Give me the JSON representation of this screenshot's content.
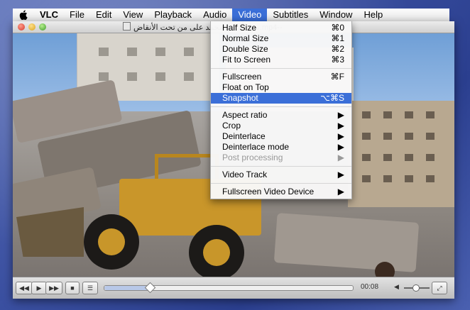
{
  "menubar": {
    "items": [
      "VLC",
      "File",
      "Edit",
      "View",
      "Playback",
      "Audio",
      "Video",
      "Subtitles",
      "Window",
      "Help"
    ],
    "active": "Video"
  },
  "window": {
    "title": "مفاجأة في محمد على من تحت الأنقاض.mp4--"
  },
  "video_menu": {
    "items": [
      {
        "label": "Half Size",
        "shortcut": "⌘0"
      },
      {
        "label": "Normal Size",
        "shortcut": "⌘1"
      },
      {
        "label": "Double Size",
        "shortcut": "⌘2"
      },
      {
        "label": "Fit to Screen",
        "shortcut": "⌘3"
      },
      {
        "label": "Fullscreen",
        "shortcut": "⌘F"
      },
      {
        "label": "Float on Top",
        "shortcut": ""
      },
      {
        "label": "Snapshot",
        "shortcut": "⌥⌘S"
      },
      {
        "label": "Aspect ratio",
        "shortcut": "▶"
      },
      {
        "label": "Crop",
        "shortcut": "▶"
      },
      {
        "label": "Deinterlace",
        "shortcut": "▶"
      },
      {
        "label": "Deinterlace mode",
        "shortcut": "▶"
      },
      {
        "label": "Post processing",
        "shortcut": "▶"
      },
      {
        "label": "Video Track",
        "shortcut": "▶"
      },
      {
        "label": "Fullscreen Video Device",
        "shortcut": "▶"
      }
    ],
    "highlighted": "Snapshot",
    "disabled": [
      "Post processing"
    ]
  },
  "controller": {
    "rewind_icon": "◀◀",
    "play_icon": "▶",
    "forward_icon": "▶▶",
    "stop_icon": "■",
    "playlist_icon": "☰",
    "time": "00:08",
    "fullscreen_icon": "⤢",
    "seek_progress": 0.18,
    "volume_level": 0.45
  },
  "colors": {
    "menu_highlight": "#3b6fd8",
    "background": "#3a4fa0"
  }
}
